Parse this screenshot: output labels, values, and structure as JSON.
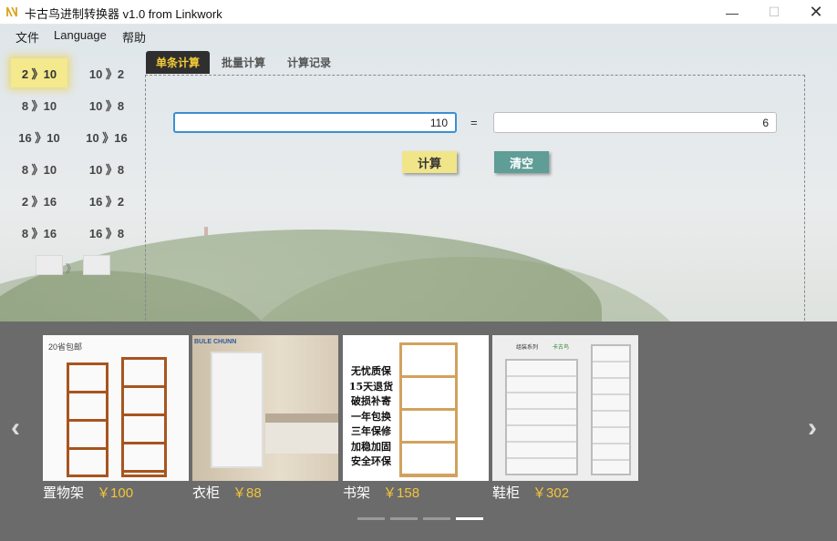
{
  "window": {
    "title": "卡古鸟进制转换器 v1.0 from Linkwork",
    "minimize_glyph": "—",
    "maximize_glyph": "☐",
    "close_glyph": "✕"
  },
  "menu": {
    "file": "文件",
    "language": "Language",
    "help": "帮助"
  },
  "conversions": [
    {
      "label": "2 》10",
      "active": true
    },
    {
      "label": "10 》2"
    },
    {
      "label": "8 》10"
    },
    {
      "label": "10 》8"
    },
    {
      "label": "16 》10"
    },
    {
      "label": "10 》16"
    },
    {
      "label": "8 》10"
    },
    {
      "label": "10 》8"
    },
    {
      "label": "2 》16"
    },
    {
      "label": "16 》2"
    },
    {
      "label": "8 》16"
    },
    {
      "label": "16 》8"
    }
  ],
  "custom_convert": {
    "arrow": "》"
  },
  "tabs": [
    {
      "label": "单条计算",
      "active": true
    },
    {
      "label": "批量计算"
    },
    {
      "label": "计算记录"
    }
  ],
  "calculator": {
    "input_value": "110",
    "equals": "=",
    "output_value": "6",
    "calculate_label": "计算",
    "clear_label": "清空"
  },
  "ads": {
    "prev_glyph": "‹",
    "next_glyph": "›",
    "products": [
      {
        "name": "置物架",
        "price": "￥100"
      },
      {
        "name": "衣柜",
        "price": "￥88"
      },
      {
        "name": "书架",
        "price": "￥158"
      },
      {
        "name": "鞋柜",
        "price": "￥302"
      }
    ],
    "image_texts": {
      "shelf_badge": "20省包邮",
      "wardrobe_brand": "BULE CHUNN",
      "bookshelf_slogan": "无忧质保 15天退货 破损补寄 一年包换 三年保修 加稳加固 安全环保",
      "cabinet_badge": "组装系列",
      "cabinet_brand": "卡古鸟"
    },
    "active_page": 4,
    "page_count": 4
  }
}
